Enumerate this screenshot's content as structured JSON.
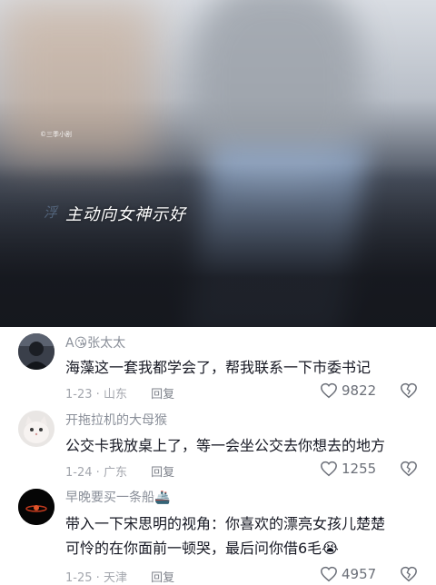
{
  "video": {
    "watermark": "©三季小剧",
    "caption": "主动向女神示好",
    "caption_ghost": "浮"
  },
  "comments": [
    {
      "username": "A😘张太太",
      "text": "海藻这一套我都学会了，帮我联系一下市委书记",
      "date": "1-23",
      "location": "山东",
      "reply_label": "回复",
      "likes": "9822",
      "avatar_icon": "dark-portrait-avatar"
    },
    {
      "username": "开拖拉机的大母猴",
      "text": "公交卡我放桌上了，等一会坐公交去你想去的地方",
      "date": "1-24",
      "location": "广东",
      "reply_label": "回复",
      "likes": "1255",
      "avatar_icon": "cat-avatar"
    },
    {
      "username": "早晚要买一条船🚢",
      "text_line1": "带入一下宋思明的视角：你喜欢的漂亮女孩儿楚楚",
      "text_line2": "可怜的在你面前一顿哭，最后问你借6毛😭",
      "date": "1-25",
      "location": "天津",
      "reply_label": "回复",
      "likes": "4957",
      "avatar_icon": "dark-sunset-avatar"
    }
  ],
  "colors": {
    "text": "#161823",
    "meta": "#a3a6ad",
    "username": "#8a8f99"
  }
}
